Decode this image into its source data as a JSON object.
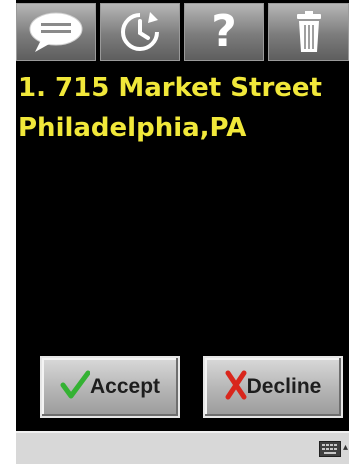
{
  "toolbar": {
    "buttons": [
      {
        "icon": "speech-bubble-icon"
      },
      {
        "icon": "clock-refresh-icon"
      },
      {
        "icon": "help-icon",
        "glyph": "?"
      },
      {
        "icon": "trash-icon"
      }
    ]
  },
  "address": {
    "line1": "1. 715 Market Street",
    "line2": "Philadelphia,PA"
  },
  "actions": {
    "accept_label": "Accept",
    "decline_label": "Decline"
  },
  "statusbar": {
    "icon": "keyboard-icon"
  },
  "colors": {
    "background": "#000000",
    "address_text": "#f1e83a",
    "accept_check": "#34b233",
    "decline_x": "#d9261c"
  }
}
